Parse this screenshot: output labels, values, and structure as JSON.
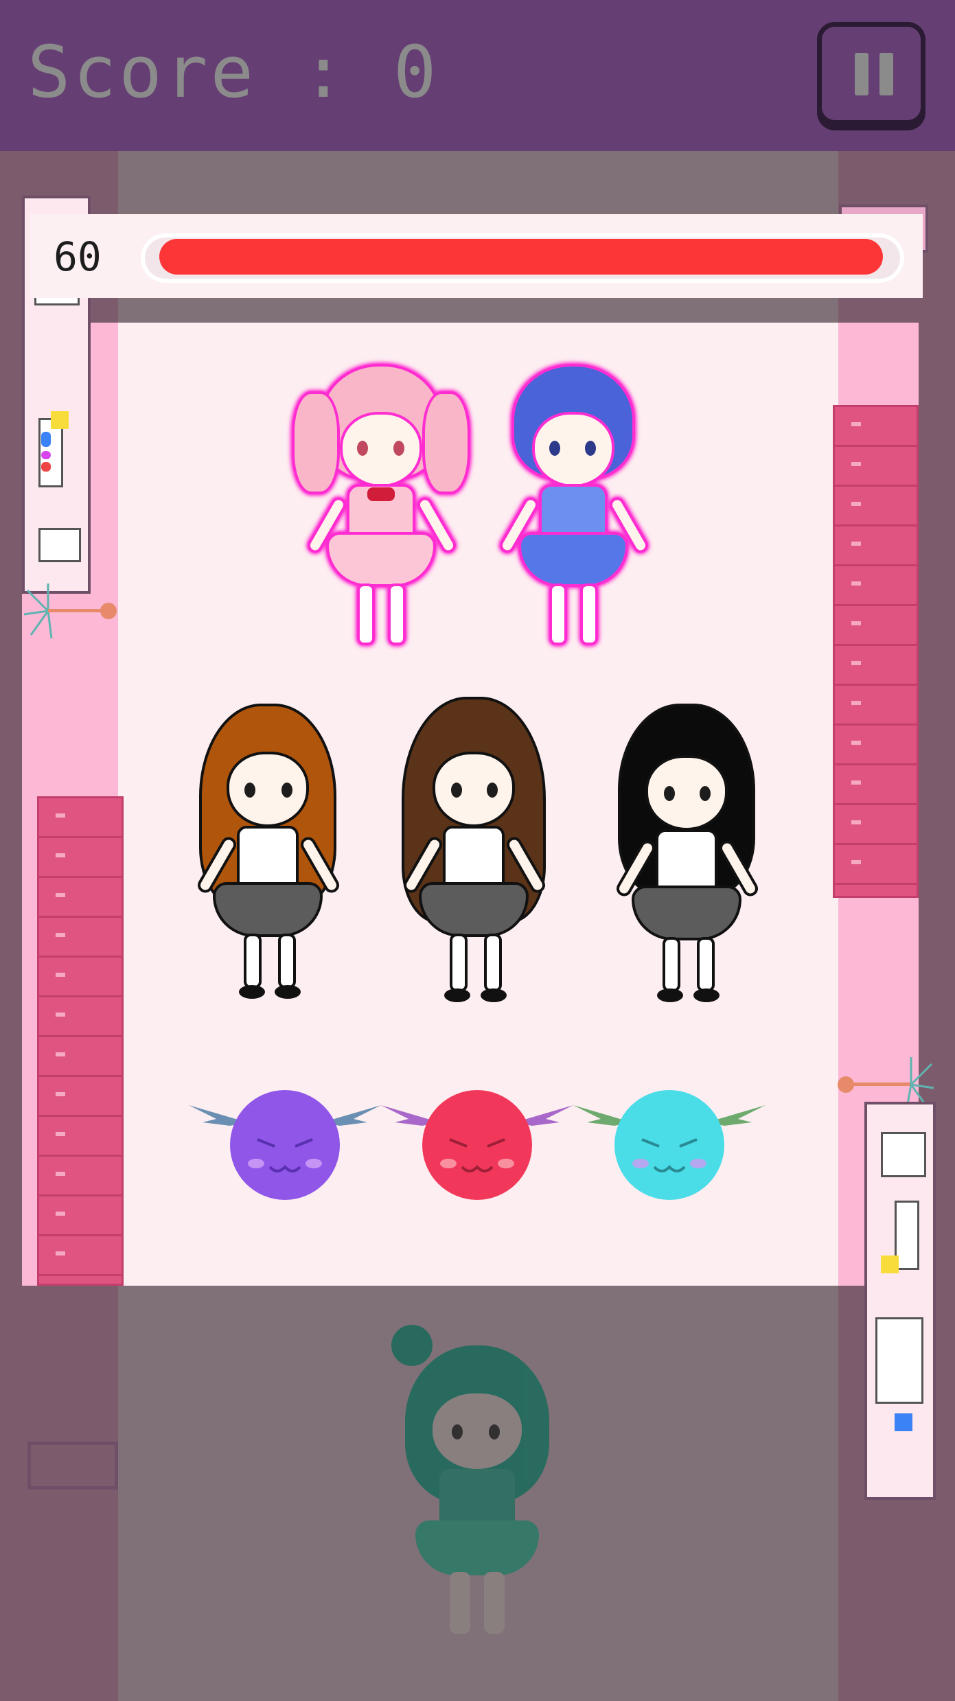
{
  "hud": {
    "score_label": "Score : 0",
    "pause_icon": "pause-icon",
    "timer_value": "60",
    "timer_progress": 1.0
  },
  "colors": {
    "header_bg": "#653f73",
    "timer_fill": "#fc3636",
    "panel_bg": "#fdeef1",
    "locker": "#e05482"
  },
  "characters": {
    "top_row": [
      "pink-idol",
      "blue-idol"
    ],
    "middle_row": [
      "brown-hair-girl",
      "long-brown-hair-girl",
      "black-hair-girl"
    ],
    "devils": [
      "purple-devil",
      "red-devil",
      "cyan-devil"
    ],
    "incoming": "green-idol"
  }
}
